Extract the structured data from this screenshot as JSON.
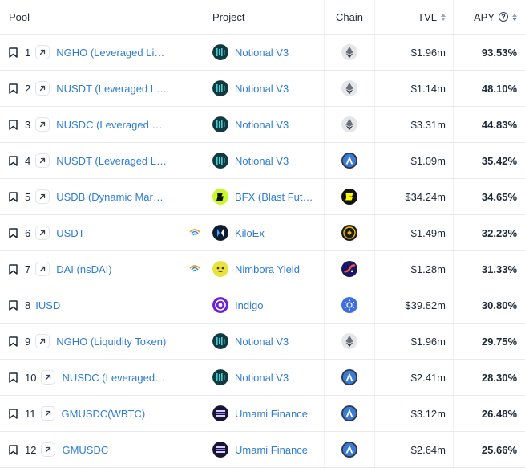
{
  "header": {
    "pool": "Pool",
    "project": "Project",
    "chain": "Chain",
    "tvl": "TVL",
    "apy": "APY",
    "help_glyph": "?"
  },
  "colors": {
    "link": "#2f7dd6",
    "border": "#e7e9ee",
    "sort_active": "#2f7dd6"
  },
  "rows": [
    {
      "rank": "1",
      "pool": "NGHO (Leveraged Liquidity Token)",
      "project": "Notional V3",
      "project_logo": "notional-logo",
      "chain": "ethereum-icon",
      "tvl": "$1.96m",
      "apy": "93.53%"
    },
    {
      "rank": "2",
      "pool": "NUSDT (Leveraged Liquidity Token)",
      "project": "Notional V3",
      "project_logo": "notional-logo",
      "chain": "ethereum-icon",
      "tvl": "$1.14m",
      "apy": "48.10%"
    },
    {
      "rank": "3",
      "pool": "NUSDC (Leveraged Liquidity Token)",
      "project": "Notional V3",
      "project_logo": "notional-logo",
      "chain": "ethereum-icon",
      "tvl": "$3.31m",
      "apy": "44.83%"
    },
    {
      "rank": "4",
      "pool": "NUSDT (Leveraged Liquidity Token)",
      "project": "Notional V3",
      "project_logo": "notional-logo",
      "chain": "arbitrum-icon",
      "tvl": "$1.09m",
      "apy": "35.42%"
    },
    {
      "rank": "5",
      "pool": "USDB (Dynamic Market Maker)",
      "project": "BFX (Blast Futures)",
      "project_logo": "bfx-logo",
      "chain": "blast-icon",
      "tvl": "$34.24m",
      "apy": "34.65%"
    },
    {
      "rank": "6",
      "pool": "USDT",
      "project": "KiloEx",
      "project_logo": "kiloex-logo",
      "chain": "opbnb-icon",
      "tvl": "$1.49m",
      "apy": "32.23%",
      "rainbow": true
    },
    {
      "rank": "7",
      "pool": "DAI (nsDAI)",
      "project": "Nimbora Yield",
      "project_logo": "nimbora-logo",
      "chain": "starknet-icon",
      "tvl": "$1.28m",
      "apy": "31.33%",
      "rainbow": true
    },
    {
      "rank": "8",
      "pool": "IUSD",
      "project": "Indigo",
      "project_logo": "indigo-logo",
      "chain": "cardano-icon",
      "tvl": "$39.82m",
      "apy": "30.80%",
      "no_ext": true
    },
    {
      "rank": "9",
      "pool": "NGHO (Liquidity Token)",
      "project": "Notional V3",
      "project_logo": "notional-logo",
      "chain": "ethereum-icon",
      "tvl": "$1.96m",
      "apy": "29.75%"
    },
    {
      "rank": "10",
      "pool": "NUSDC (Leveraged Liquidity Token)",
      "project": "Notional V3",
      "project_logo": "notional-logo",
      "chain": "arbitrum-icon",
      "tvl": "$2.41m",
      "apy": "28.30%"
    },
    {
      "rank": "11",
      "pool": "GMUSDC(WBTC)",
      "project": "Umami Finance",
      "project_logo": "umami-logo",
      "chain": "arbitrum-icon",
      "tvl": "$3.12m",
      "apy": "26.48%"
    },
    {
      "rank": "12",
      "pool": "GMUSDC",
      "project": "Umami Finance",
      "project_logo": "umami-logo",
      "chain": "arbitrum-icon",
      "tvl": "$2.64m",
      "apy": "25.66%"
    }
  ]
}
